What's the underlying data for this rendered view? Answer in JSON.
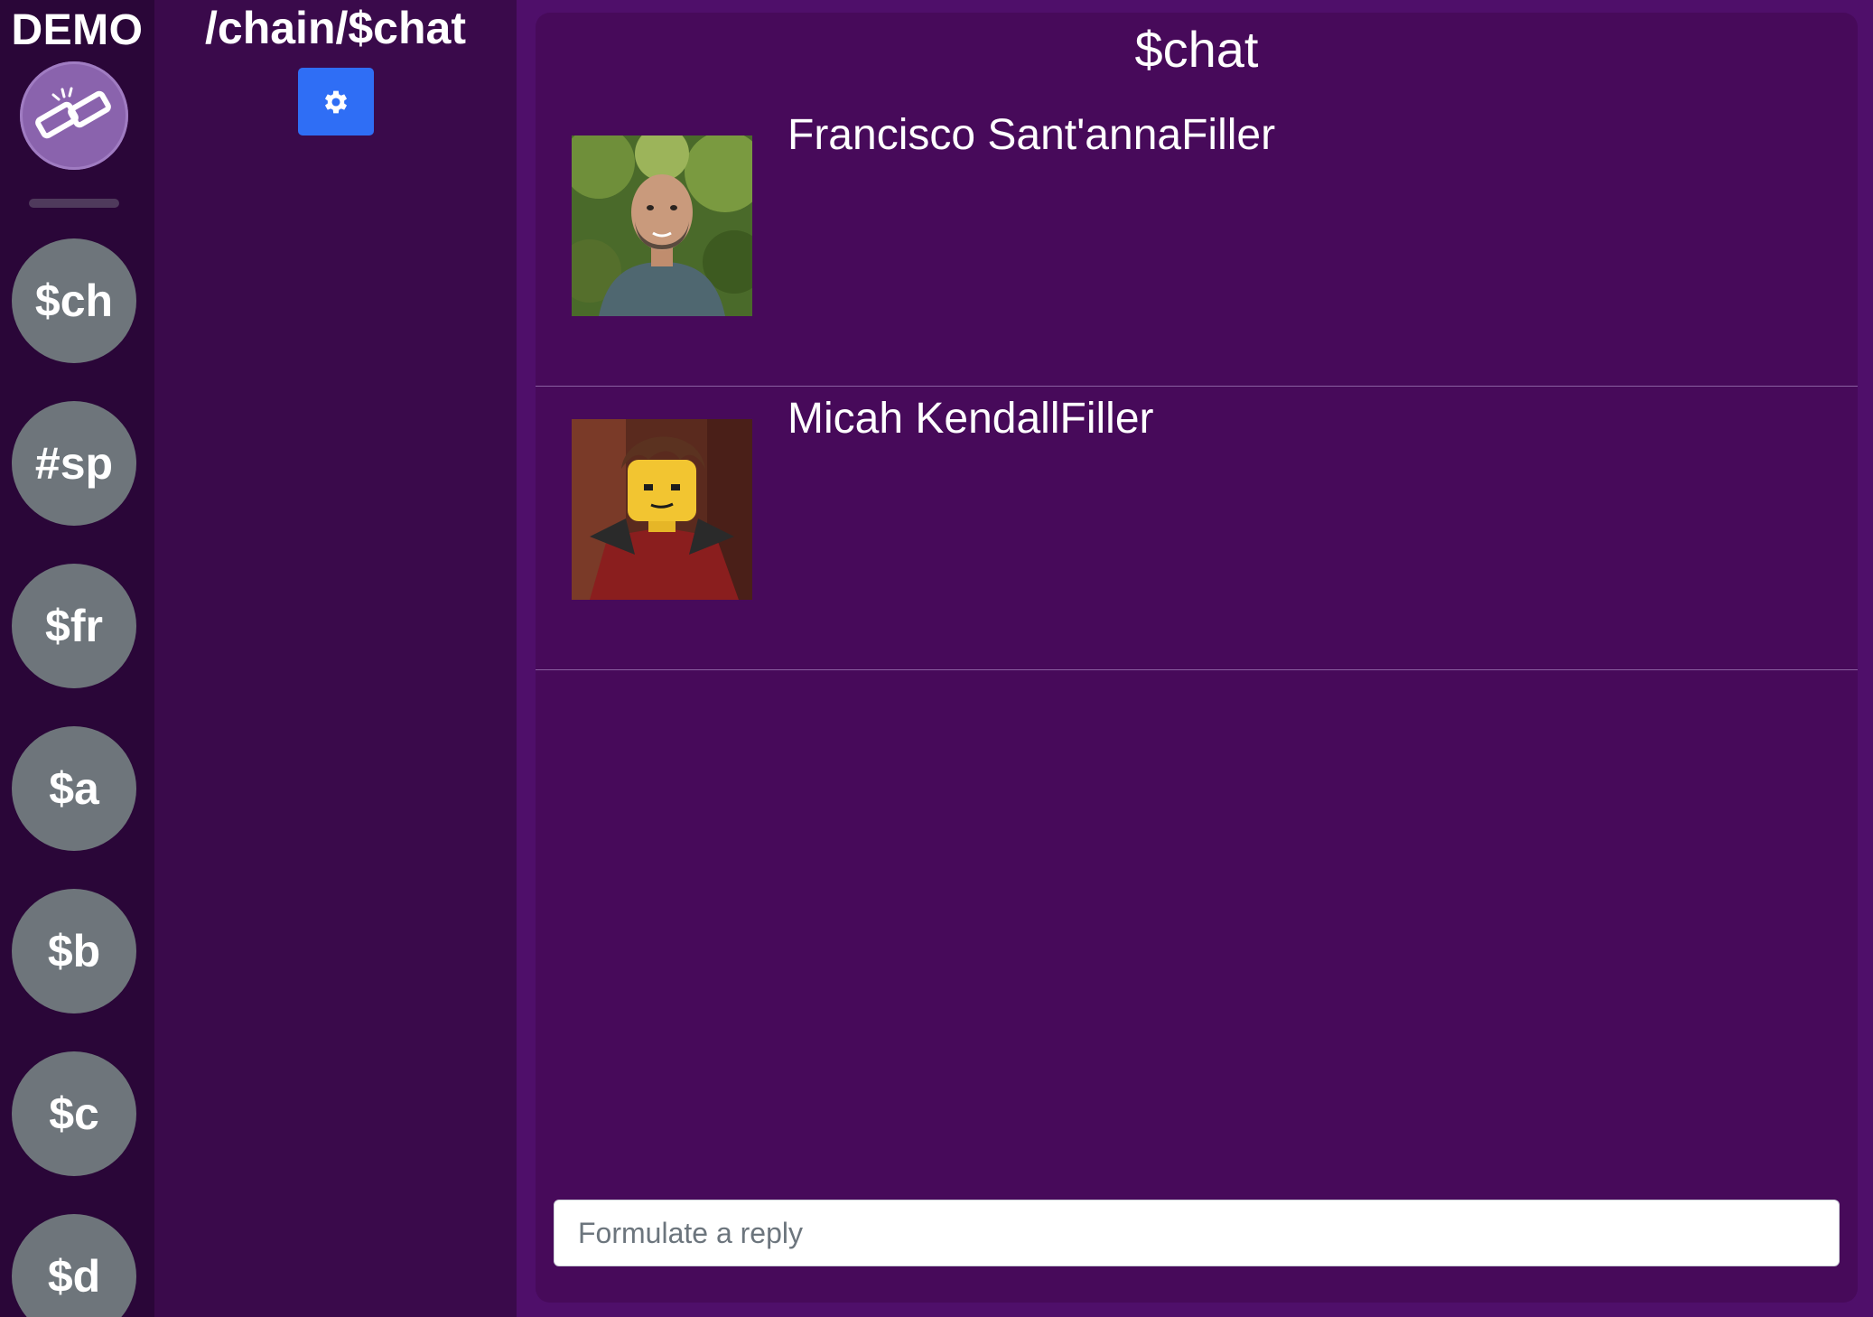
{
  "rail": {
    "brand": "DEMO",
    "channels": [
      {
        "label": "$ch"
      },
      {
        "label": "#sp"
      },
      {
        "label": "$fr"
      },
      {
        "label": "$a"
      },
      {
        "label": "$b"
      },
      {
        "label": "$c"
      },
      {
        "label": "$d"
      }
    ]
  },
  "channel_column": {
    "path": "/chain/$chat",
    "settings_icon": "gear-icon"
  },
  "chat": {
    "title": "$chat",
    "messages": [
      {
        "name": "Francisco Sant'annaFiller",
        "avatar": "photo of bearded man in blue t-shirt"
      },
      {
        "name": "Micah KendallFiller",
        "avatar": "lego ninja minifigure in red armor"
      }
    ],
    "reply": {
      "placeholder": "Formulate a reply"
    }
  },
  "colors": {
    "rail_bg": "#2a0638",
    "column_bg": "#3a0a4b",
    "panel_bg": "#470a5a",
    "channel_button": "#6e757b",
    "settings_button": "#2f6ef5"
  }
}
